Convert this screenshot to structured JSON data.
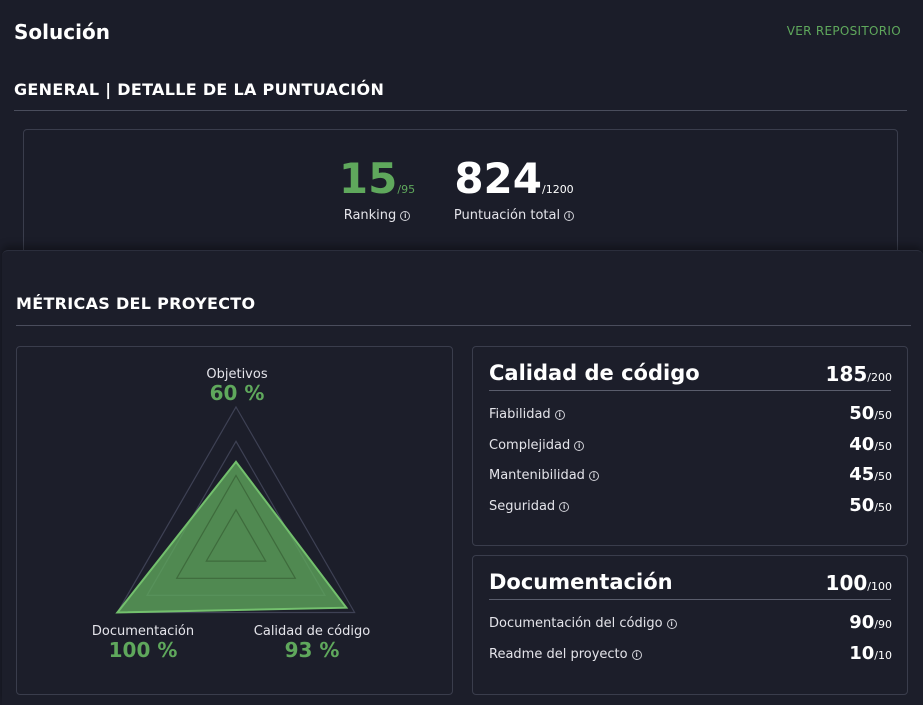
{
  "header": {
    "title": "Solución",
    "repo_link": "VER REPOSITORIO"
  },
  "general": {
    "title": "GENERAL | DETALLE DE LA PUNTUACIÓN",
    "ranking": {
      "value": "15",
      "out_of": "/95",
      "label": "Ranking"
    },
    "total": {
      "value": "824",
      "out_of": "/1200",
      "label": "Puntuación total"
    }
  },
  "metrics": {
    "title": "MÉTRICAS DEL PROYECTO",
    "radar": {
      "axes": [
        {
          "label": "Objetivos",
          "value_text": "60 %",
          "value": 60
        },
        {
          "label": "Calidad de código",
          "value_text": "93 %",
          "value": 93
        },
        {
          "label": "Documentación",
          "value_text": "100 %",
          "value": 100
        }
      ],
      "fill_color": "#5fa85c"
    },
    "quality": {
      "title": "Calidad de código",
      "score": "185",
      "out_of": "/200",
      "items": [
        {
          "label": "Fiabilidad",
          "score": "50",
          "out_of": "/50"
        },
        {
          "label": "Complejidad",
          "score": "40",
          "out_of": "/50"
        },
        {
          "label": "Mantenibilidad",
          "score": "45",
          "out_of": "/50"
        },
        {
          "label": "Seguridad",
          "score": "50",
          "out_of": "/50"
        }
      ]
    },
    "documentation": {
      "title": "Documentación",
      "score": "100",
      "out_of": "/100",
      "items": [
        {
          "label": "Documentación del código",
          "score": "90",
          "out_of": "/90"
        },
        {
          "label": "Readme del proyecto",
          "score": "10",
          "out_of": "/10"
        }
      ]
    }
  },
  "colors": {
    "accent": "#5fa85c",
    "background": "#1b1d29",
    "border": "#3a3d4c"
  },
  "icons": {
    "info": "info-circle-icon"
  }
}
